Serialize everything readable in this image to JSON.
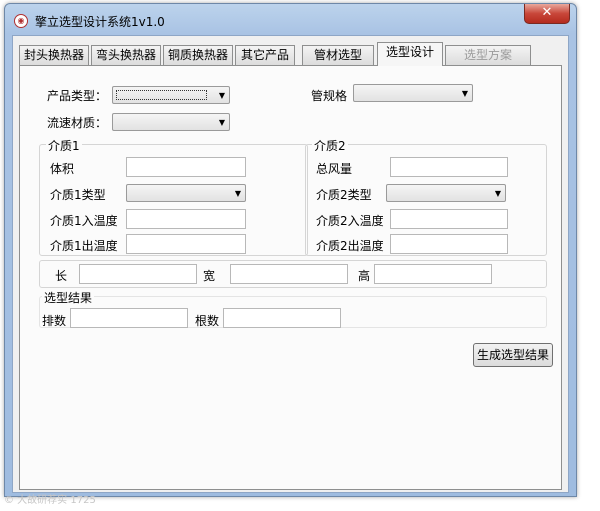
{
  "window": {
    "title": "擎立选型设计系统1v1.0",
    "close_label": "✕"
  },
  "tabs": [
    {
      "label": "封头换热器"
    },
    {
      "label": "弯头换热器"
    },
    {
      "label": "铜质换热器"
    },
    {
      "label": "其它产品"
    },
    {
      "label": "管材选型"
    },
    {
      "label": "选型设计",
      "active": true
    },
    {
      "label": "选型方案",
      "disabled": true
    }
  ],
  "form": {
    "product_type_label": "产品类型：",
    "product_type_value": "",
    "pipe_spec_label": "管规格",
    "pipe_spec_value": "",
    "flow_material_label": "流速材质：",
    "flow_material_value": ""
  },
  "medium1": {
    "title": "介质1",
    "volume_label": "体积",
    "type_label": "介质1类型",
    "in_temp_label": "介质1入温度",
    "out_temp_label": "介质1出温度"
  },
  "medium2": {
    "title": "介质2",
    "air_volume_label": "总风量",
    "type_label": "介质2类型",
    "in_temp_label": "介质2入温度",
    "out_temp_label": "介质2出温度"
  },
  "dimensions": {
    "length_label": "长",
    "width_label": "宽",
    "height_label": "高"
  },
  "result": {
    "title": "选型结果",
    "rows_label": "排数",
    "count_label": "根数",
    "generate_button": "生成选型结果"
  },
  "icons": {
    "app": "app-icon",
    "dropdown": "chevron-down-icon"
  },
  "footer": {
    "credit": "© 大故研荐实 1725"
  }
}
